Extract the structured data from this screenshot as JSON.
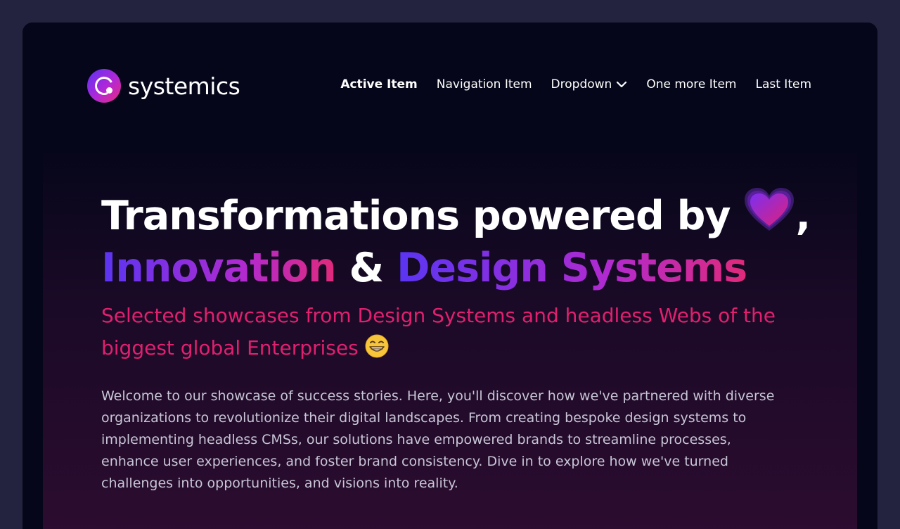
{
  "brand": {
    "name": "systemics"
  },
  "nav": {
    "items": [
      {
        "label": "Active Item",
        "active": true
      },
      {
        "label": "Navigation Item"
      },
      {
        "label": "Dropdown",
        "has_dropdown": true
      },
      {
        "label": "One more Item"
      },
      {
        "label": "Last Item"
      }
    ]
  },
  "hero": {
    "headline_line1": "Transformations powered by",
    "headline_line1_suffix": ",",
    "heart_icon": "purple-heart-emoji",
    "headline_word1": "Innovation",
    "headline_amp": "&",
    "headline_word2": "Design Systems",
    "subheading": "Selected showcases from Design Systems and headless Webs of the biggest global Enterprises",
    "subheading_icon": "grinning-face-emoji",
    "body": "Welcome to our showcase of success stories. Here, you'll discover how we've partnered with diverse organizations to revolutionize their digital landscapes. From creating bespoke design systems to implementing headless CMSs, our solutions have empowered brands to streamline processes, enhance user experiences, and foster brand consistency. Dive in to explore how we've turned challenges into opportunities, and visions into reality."
  },
  "colors": {
    "page_bg": "#24233f",
    "frame_bg": "#050619",
    "accent_pink": "#e0206e",
    "accent_purple": "#5a35f2"
  }
}
